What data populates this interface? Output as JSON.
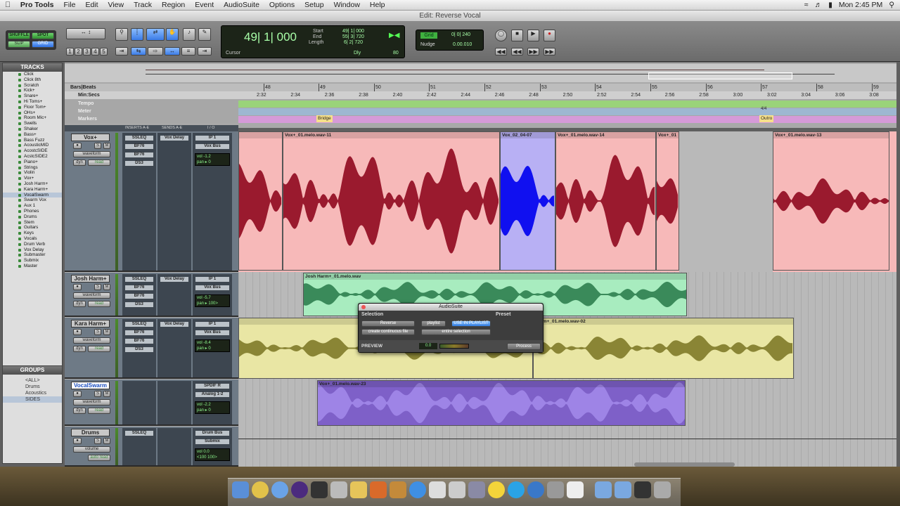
{
  "menubar": {
    "app": "Pro Tools",
    "items": [
      "File",
      "Edit",
      "View",
      "Track",
      "Region",
      "Event",
      "AudioSuite",
      "Options",
      "Setup",
      "Window",
      "Help"
    ],
    "clock": "Mon 2:45 PM"
  },
  "window": {
    "title": "Edit: Reverse Vocal"
  },
  "toolbar": {
    "modes": [
      "SHUFFLE",
      "SPOT",
      "SLIP",
      "GRID"
    ],
    "zoom_presets": [
      "1",
      "2",
      "3",
      "4",
      "5"
    ],
    "main_counter": "49| 1| 000",
    "counter_label": "Cursor",
    "start_label": "Start",
    "end_label": "End",
    "length_label": "Length",
    "start": "49| 1| 000",
    "end": "55| 3| 720",
    "length": "6| 2| 720",
    "grid_label": "Grid",
    "grid_value": "0| 0| 240",
    "nudge_label": "Nudge",
    "nudge_value": "0.00.010",
    "dly": "Dly",
    "tempo": "80"
  },
  "tracks_panel": {
    "title": "TRACKS",
    "items": [
      "Click",
      "Click 8th",
      "Scratch",
      "Kick+",
      "Snare+",
      "Hi Toms+",
      "Floor Tom+",
      "OHs+",
      "Room Mic+",
      "Swells",
      "Shaker",
      "Bass+",
      "Bass Fuzz",
      "AcousticMID",
      "AcostcSIDE",
      "AcstcSIDE2",
      "Piano+",
      "Strings",
      "Violin",
      "Vox+",
      "Josh Harm+",
      "Kara Harm+",
      "VocalSwarm",
      "Swarm Vox",
      "Aux 1",
      "Phones",
      "Drums",
      "Stem",
      "Guitars",
      "Keys",
      "Vocals",
      "Drum Verb",
      "Vox Delay",
      "Submaster",
      "Submix",
      "Master"
    ],
    "selected": "VocalSwarm"
  },
  "groups_panel": {
    "title": "GROUPS",
    "items": [
      "<ALL>",
      "Drums",
      "Acoustics",
      "SIDES"
    ]
  },
  "rulers": {
    "bars_label": "Bars|Beats",
    "minsecs_label": "Min:Secs",
    "tempo_label": "Tempo",
    "meter_label": "Meter",
    "markers_label": "Markers",
    "bars": [
      "48",
      "49",
      "50",
      "51",
      "52",
      "53",
      "54",
      "55",
      "56",
      "57",
      "58",
      "59"
    ],
    "times": [
      "2:32",
      "2:34",
      "2:36",
      "2:38",
      "2:40",
      "2:42",
      "2:44",
      "2:46",
      "2:48",
      "2:50",
      "2:52",
      "2:54",
      "2:56",
      "2:58",
      "3:00",
      "3:02",
      "3:04",
      "3:06",
      "3:08"
    ],
    "marker_bridge": "Bridge",
    "marker_outro": "Outro",
    "meter_value": "4/4"
  },
  "edit_headers": {
    "inserts": "INSERTS A-E",
    "sends": "SENDS A-E",
    "io": "I / O"
  },
  "tracks": [
    {
      "name": "Vox+",
      "inserts": [
        "SSLEQ",
        "BF76",
        "BF76",
        "DS3"
      ],
      "send": "Vox Delay",
      "input": "IP 1",
      "output": "Vox Bus",
      "view": "waveform",
      "dyn": "dyn",
      "mode": "read",
      "vol": "-1.2",
      "pan": "0",
      "s": "S",
      "m": "M"
    },
    {
      "name": "Josh Harm+",
      "inserts": [
        "SSLEQ",
        "BF76",
        "BF76",
        "DS3"
      ],
      "send": "Vox Delay",
      "input": "IP 1",
      "output": "Vox Bus",
      "view": "waveform",
      "dyn": "dyn",
      "mode": "read",
      "vol": "-5.7",
      "pan": "100>",
      "s": "S",
      "m": "M"
    },
    {
      "name": "Kara Harm+",
      "inserts": [
        "SSLEQ",
        "BF76",
        "BF76",
        "DS3"
      ],
      "send": "Vox Delay",
      "input": "IP 1",
      "output": "Vox Bus",
      "view": "waveform",
      "dyn": "dyn",
      "mode": "read",
      "vol": "-8.4",
      "pan": "0",
      "s": "S",
      "m": "M"
    },
    {
      "name": "VocalSwarm",
      "inserts": [],
      "send": "",
      "input": "SPDIF R",
      "output": "Analog 1-2",
      "view": "waveform",
      "dyn": "dyn",
      "mode": "read",
      "vol": "-2.2",
      "pan": "0",
      "s": "S",
      "m": "M"
    },
    {
      "name": "Drums",
      "inserts": [
        "SSLEQ"
      ],
      "send": "",
      "input": "Drum Bus",
      "output": "Submix",
      "view": "volume",
      "dyn": "",
      "mode": "auto read",
      "vol": "0.0",
      "pan": "<100",
      "pan2": "100>",
      "s": "S",
      "m": "M"
    }
  ],
  "regions": {
    "vox": [
      "Vox+_01.melo.wav-11",
      "Vox_02_04-07",
      "Vox+_01.melo.wav-14",
      "Vox+_01",
      "Vox+_01.melo.wav-13"
    ],
    "josh": "Josh Harm+_01.melo.wav",
    "kara": "Harm+_01.melo.wav-02",
    "swarm": "Vox+_01.melo.wav-23"
  },
  "audiosuite": {
    "title": "AudioSuite",
    "selection": "Selection",
    "preset": "Preset",
    "plugin": "Reverse",
    "playlist": "playlist",
    "use_in_playlist": "USE IN PLAYLIST",
    "continuous": "create continuous file",
    "entire": "entire selection",
    "preview": "PREVIEW",
    "value": "0.0",
    "process": "Process"
  },
  "colors": {
    "vox": "#f7b9b9",
    "vox_wave": "#9a1a2e",
    "swarm_sel": "#b8b0f4",
    "blue_wave": "#1010f0",
    "josh": "#a8ecbf",
    "josh_wave": "#3a8a5a",
    "kara": "#e9e6a4",
    "kara_wave": "#8a8535",
    "swarm": "#7e60c8",
    "swarm_wave": "#9e84e6"
  }
}
